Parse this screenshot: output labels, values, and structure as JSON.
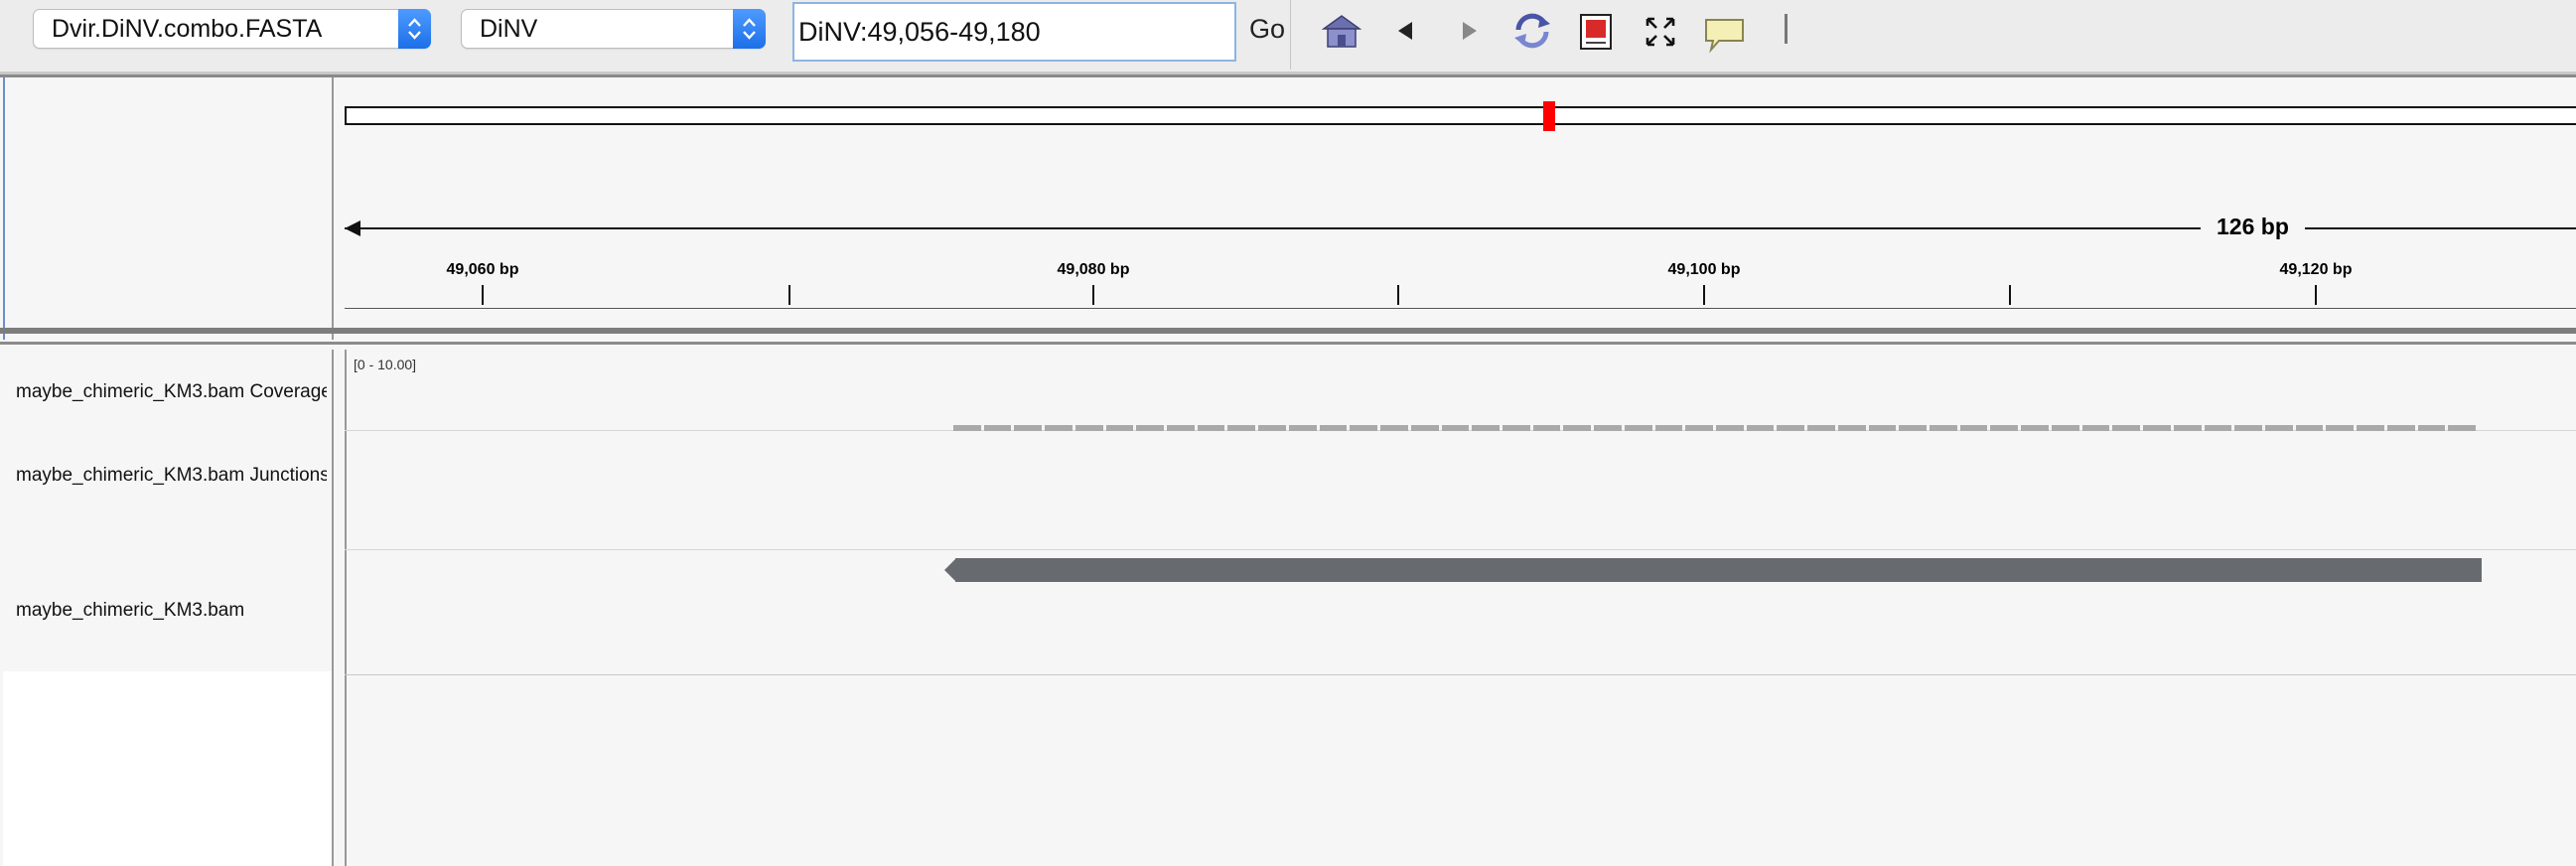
{
  "toolbar": {
    "genome_select": "Dvir.DiNV.combo.FASTA",
    "chromosome_select": "DiNV",
    "locus_value": "DiNV:49,056-49,180",
    "go_label": "Go",
    "icons": [
      "home-icon",
      "back-icon",
      "forward-icon",
      "refresh-icon",
      "region-of-interest-icon",
      "resize-to-window-icon",
      "popup-info-icon"
    ]
  },
  "ruler": {
    "span_label": "126 bp",
    "ticks": [
      "49,060 bp",
      "49,080 bp",
      "49,100 bp",
      "49,120 bp"
    ]
  },
  "tracks": [
    {
      "name": "maybe_chimeric_KM3.bam Coverage"
    },
    {
      "name": "maybe_chimeric_KM3.bam Junctions"
    },
    {
      "name": "maybe_chimeric_KM3.bam"
    }
  ],
  "coverage": {
    "range_label": "[0 - 10.00]"
  },
  "colors": {
    "read": "#676b70",
    "coverage": "#a9a9a9",
    "ideogram_marker": "#ff0000",
    "select_arrow": "#1c6fe8"
  }
}
